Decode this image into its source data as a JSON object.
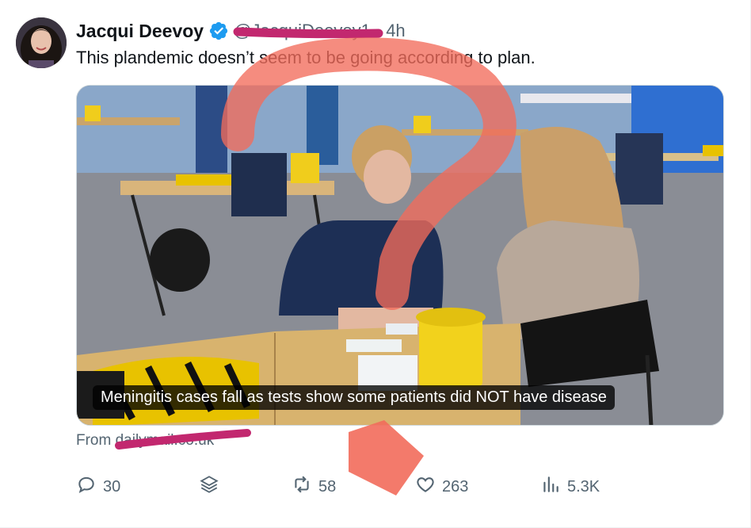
{
  "tweet": {
    "author_name": "Jacqui Deevoy",
    "handle": "@JacquiDeevoy1",
    "time": "4h",
    "text": "This plandemic doesn’t seem to be going according to plan."
  },
  "media": {
    "caption": "Meningitis cases fall as tests show some patients did NOT have disease"
  },
  "source": {
    "text": "From dailymail.co.uk"
  },
  "actions": {
    "replies": "30",
    "reposts": "58",
    "likes": "263",
    "views": "5.3K"
  },
  "icons": {
    "verified": "verified-badge-icon",
    "reply": "reply-icon",
    "stack": "layers-icon",
    "repost": "repost-icon",
    "like": "heart-icon",
    "views": "analytics-icon"
  },
  "colors": {
    "verified": "#1d9bf0",
    "secondary_text": "#536471",
    "redaction": "#c2286f",
    "annotation": "#f26b5b"
  }
}
